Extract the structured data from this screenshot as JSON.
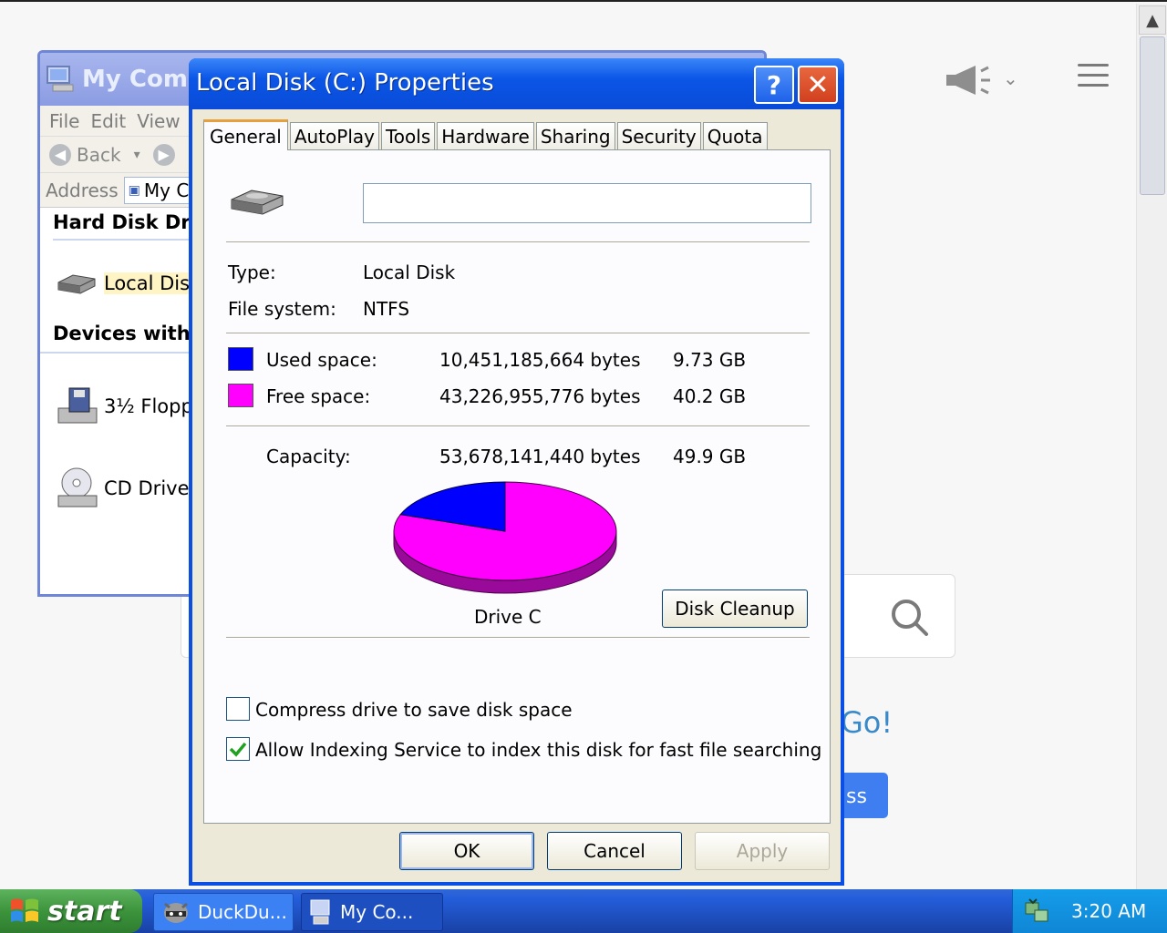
{
  "browser": {
    "tagline_fragment": "Go!",
    "button_fragment": "ss"
  },
  "mycomputer": {
    "title": "My Compu",
    "menu": [
      "File",
      "Edit",
      "View"
    ],
    "back_label": "Back",
    "address_label": "Address",
    "address_value": "My C",
    "sections": {
      "hard_disks": "Hard Disk Dri",
      "removable": "Devices with"
    },
    "items": {
      "local_disk": "Local Disk",
      "floppy": "3½ Flopp",
      "cd": "CD Drive"
    }
  },
  "dialog": {
    "title": "Local Disk (C:) Properties",
    "help": "?",
    "close": "✕",
    "tabs": [
      "General",
      "AutoPlay",
      "Tools",
      "Hardware",
      "Sharing",
      "Security",
      "Quota"
    ],
    "volume_label": "",
    "type_label": "Type:",
    "type_value": "Local Disk",
    "fs_label": "File system:",
    "fs_value": "NTFS",
    "used_label": "Used space:",
    "used_bytes": "10,451,185,664 bytes",
    "used_gb": "9.73 GB",
    "free_label": "Free space:",
    "free_bytes": "43,226,955,776 bytes",
    "free_gb": "40.2 GB",
    "capacity_label": "Capacity:",
    "capacity_bytes": "53,678,141,440 bytes",
    "capacity_gb": "49.9 GB",
    "drive_caption": "Drive C",
    "disk_cleanup": "Disk Cleanup",
    "compress_label": "Compress drive to save disk space",
    "compress_checked": false,
    "index_label": "Allow Indexing Service to index this disk for fast file searching",
    "index_checked": true,
    "ok": "OK",
    "cancel": "Cancel",
    "apply": "Apply",
    "colors": {
      "used": "#0000ff",
      "free": "#ff00ff"
    },
    "usage_fraction": {
      "used": 0.1947,
      "free": 0.8053
    }
  },
  "taskbar": {
    "start": "start",
    "tasks": [
      "DuckDu...",
      "My Co..."
    ],
    "clock": "3:20 AM"
  },
  "icons": [
    "drive-icon",
    "megaphone-icon",
    "chevron-down-icon",
    "menu-icon",
    "search-icon",
    "windows-logo-icon",
    "raccoon-icon",
    "computer-icon",
    "network-tray-icon",
    "floppy-icon",
    "cd-icon"
  ]
}
